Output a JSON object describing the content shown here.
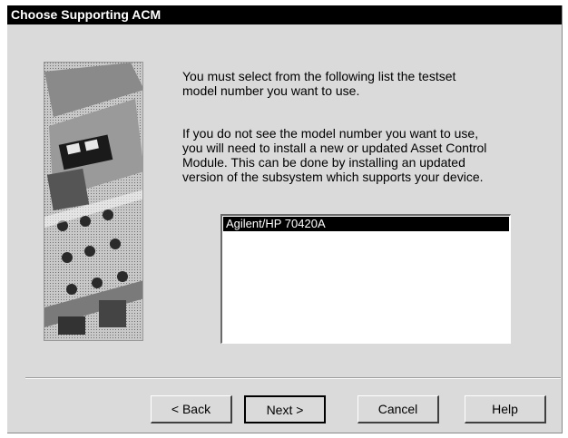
{
  "window": {
    "title": "Choose Supporting ACM"
  },
  "content": {
    "instruction_1": "You must select from the following list the testset\nmodel number you want to use.",
    "instruction_2": "If you do not see the model number you want to use,\nyou will need to install a new or updated Asset Control\nModule.  This can be done by installing an updated\nversion of the subsystem which supports your device.",
    "list": {
      "items": [
        "Agilent/HP 70420A"
      ],
      "selected_index": 0
    }
  },
  "buttons": {
    "back": "< Back",
    "next": "Next >",
    "cancel": "Cancel",
    "help": "Help"
  },
  "image": {
    "icon": "test-equipment-photo"
  }
}
